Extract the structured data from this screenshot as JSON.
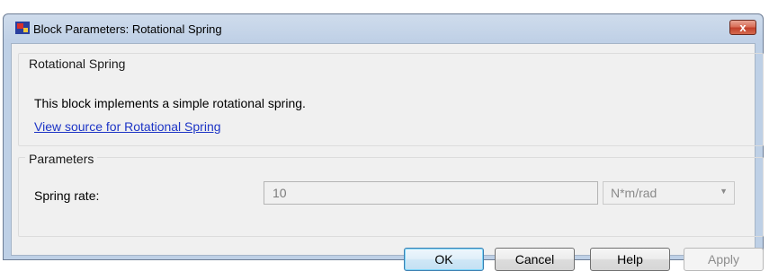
{
  "window": {
    "title": "Block Parameters: Rotational Spring",
    "close_glyph": "x"
  },
  "description_group": {
    "legend": "Rotational Spring",
    "description": "This block implements a simple rotational spring.",
    "source_link": "View source for Rotational Spring"
  },
  "parameters_group": {
    "legend": "Parameters",
    "spring_rate": {
      "label": "Spring rate:",
      "value": "10",
      "unit": "N*m/rad"
    }
  },
  "buttons": {
    "ok": "OK",
    "cancel": "Cancel",
    "help": "Help",
    "apply": "Apply"
  },
  "icons": {
    "app": "simulink-block-icon",
    "close": "close-icon",
    "dropdown": "chevron-down-icon"
  }
}
